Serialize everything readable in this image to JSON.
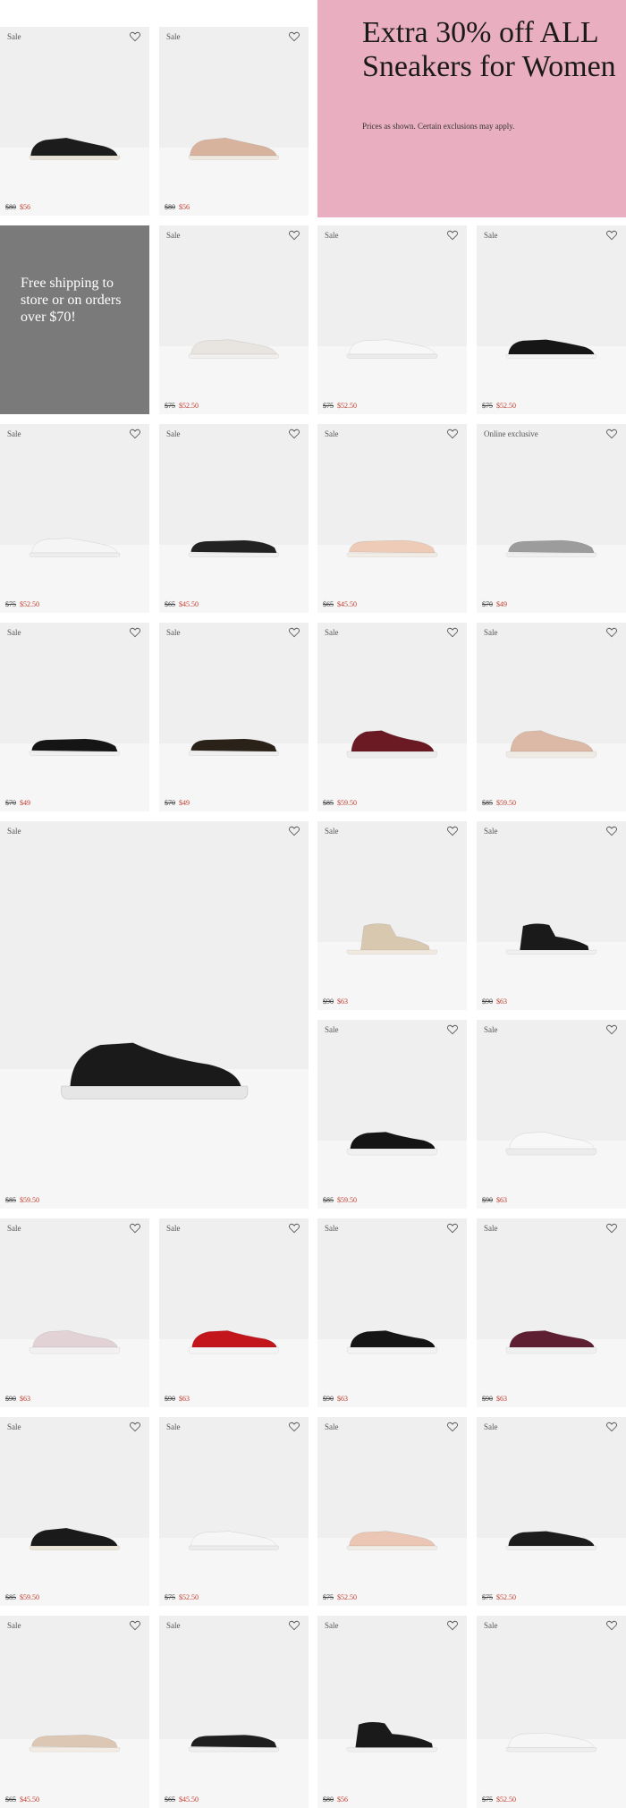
{
  "promos": {
    "sneakers_headline": "Extra 30% off ALL Sneakers for Women",
    "sneakers_note": "Prices as shown. Certain exclusions may apply.",
    "shipping_text": "Free shipping to store or on orders over $70!"
  },
  "products": [
    {
      "badge": "Sale",
      "orig": "$80",
      "sale": "$56",
      "color": "#1c1c1c",
      "sole": "#e8e2d6",
      "style": "zip-low"
    },
    {
      "badge": "Sale",
      "orig": "$80",
      "sale": "$56",
      "color": "#d7b29c",
      "sole": "#efe8de",
      "style": "zip-low"
    },
    {
      "badge": "Sale",
      "orig": "$75",
      "sale": "$52.50",
      "color": "#e8e4e0",
      "sole": "#f2f0ee",
      "style": "lace-low"
    },
    {
      "badge": "Sale",
      "orig": "$75",
      "sale": "$52.50",
      "color": "#f7f7f7",
      "sole": "#ececec",
      "style": "lace-low"
    },
    {
      "badge": "Sale",
      "orig": "$75",
      "sale": "$52.50",
      "color": "#161616",
      "sole": "#f2f2f2",
      "style": "lace-low"
    },
    {
      "badge": "Sale",
      "orig": "$75",
      "sale": "$52.50",
      "color": "#f5f5f5",
      "sole": "#eeeeee",
      "style": "lace-low"
    },
    {
      "badge": "Sale",
      "orig": "$65",
      "sale": "$45.50",
      "color": "#222222",
      "sole": "#efefef",
      "style": "slip-on"
    },
    {
      "badge": "Sale",
      "orig": "$65",
      "sale": "$45.50",
      "color": "#eecbb7",
      "sole": "#f2ece6",
      "style": "slip-on"
    },
    {
      "badge": "Online exclusive",
      "orig": "$70",
      "sale": "$49",
      "color": "#9c9c9c",
      "sole": "#efefef",
      "style": "slip-on"
    },
    {
      "badge": "Sale",
      "orig": "$70",
      "sale": "$49",
      "color": "#151515",
      "sole": "#f0f0f0",
      "style": "slip-on"
    },
    {
      "badge": "Sale",
      "orig": "$70",
      "sale": "$49",
      "color": "#2a2218",
      "sole": "#efefef",
      "style": "slip-on"
    },
    {
      "badge": "Sale",
      "orig": "$85",
      "sale": "$59.50",
      "color": "#6b1a24",
      "sole": "#ececec",
      "style": "mid-runner"
    },
    {
      "badge": "Sale",
      "orig": "$85",
      "sale": "$59.50",
      "color": "#dcb8a6",
      "sole": "#f0eae4",
      "style": "mid-runner"
    },
    {
      "badge": "Sale",
      "orig": "$85",
      "sale": "$59.50",
      "color": "#1a1a1a",
      "sole": "#e6e6e6",
      "style": "mid-runner"
    },
    {
      "badge": "Sale",
      "orig": "$90",
      "sale": "$63",
      "color": "#d8c8b0",
      "sole": "#efe9df",
      "style": "wedge-high"
    },
    {
      "badge": "Sale",
      "orig": "$90",
      "sale": "$63",
      "color": "#1a1a1a",
      "sole": "#f0f0f0",
      "style": "wedge-high"
    },
    {
      "badge": "Sale",
      "orig": "$85",
      "sale": "$59.50",
      "color": "#151515",
      "sole": "#f0f0f0",
      "style": "runner"
    },
    {
      "badge": "Sale",
      "orig": "$90",
      "sale": "$63",
      "color": "#f8f8f8",
      "sole": "#ececec",
      "style": "runner"
    },
    {
      "badge": "Sale",
      "orig": "$90",
      "sale": "$63",
      "color": "#e2d2d6",
      "sole": "#f2f0f0",
      "style": "runner"
    },
    {
      "badge": "Sale",
      "orig": "$90",
      "sale": "$63",
      "color": "#c2161c",
      "sole": "#f4f4f4",
      "style": "runner"
    },
    {
      "badge": "Sale",
      "orig": "$90",
      "sale": "$63",
      "color": "#151515",
      "sole": "#f2f2f2",
      "style": "runner"
    },
    {
      "badge": "Sale",
      "orig": "$90",
      "sale": "$63",
      "color": "#5e1f33",
      "sole": "#efefef",
      "style": "runner"
    },
    {
      "badge": "Sale",
      "orig": "$85",
      "sale": "$59.50",
      "color": "#1a1a1a",
      "sole": "#ede6d8",
      "style": "zip-low"
    },
    {
      "badge": "Sale",
      "orig": "$75",
      "sale": "$52.50",
      "color": "#f6f6f6",
      "sole": "#ececec",
      "style": "lace-low"
    },
    {
      "badge": "Sale",
      "orig": "$75",
      "sale": "$52.50",
      "color": "#ecc6b4",
      "sole": "#f2ece6",
      "style": "lace-low"
    },
    {
      "badge": "Sale",
      "orig": "$75",
      "sale": "$52.50",
      "color": "#1c1c1c",
      "sole": "#f0f0f0",
      "style": "lace-low"
    },
    {
      "badge": "Sale",
      "orig": "$65",
      "sale": "$45.50",
      "color": "#dcc7b4",
      "sole": "#f2ece4",
      "style": "slip-on"
    },
    {
      "badge": "Sale",
      "orig": "$65",
      "sale": "$45.50",
      "color": "#1e1e1e",
      "sole": "#eeeeee",
      "style": "slip-on"
    },
    {
      "badge": "Sale",
      "orig": "$80",
      "sale": "$56",
      "color": "#1a1a1a",
      "sole": "#f0f0f0",
      "style": "high-top"
    },
    {
      "badge": "Sale",
      "orig": "$75",
      "sale": "$52.50",
      "color": "#f6f6f6",
      "sole": "#eeeeee",
      "style": "lace-low"
    }
  ]
}
